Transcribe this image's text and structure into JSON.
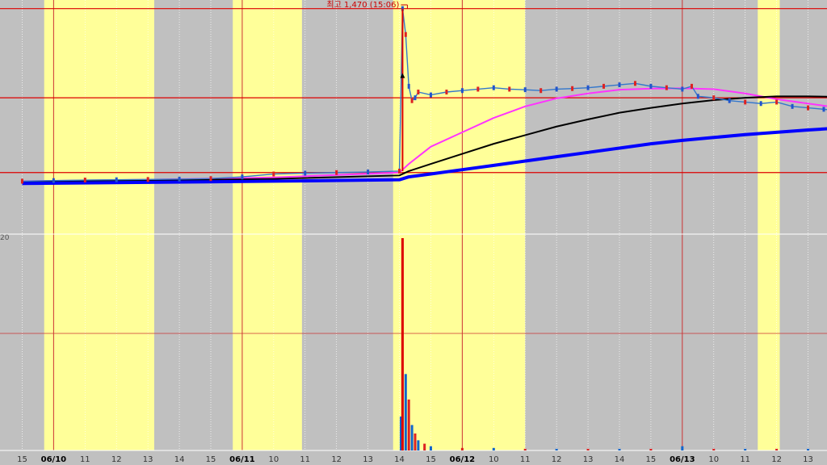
{
  "chart_data": {
    "type": "line",
    "title": "",
    "xlabel": "",
    "ylabel": "",
    "ylim": [
      700,
      1500
    ],
    "grid": true,
    "legend": "none",
    "time_ticks": [
      "15",
      "06/10",
      "11",
      "12",
      "13",
      "14",
      "15",
      "06/11",
      "10",
      "11",
      "12",
      "13",
      "14",
      "15",
      "06/12",
      "10",
      "11",
      "12",
      "13",
      "14",
      "15",
      "06/13",
      "10",
      "11",
      "12",
      "13"
    ],
    "date_ticks": [
      "06/10",
      "06/11",
      "06/12",
      "06/13"
    ],
    "y_axis_label": "20",
    "annotation": {
      "text": "최고 1,470 (15:06)",
      "x": 12.1,
      "y": 1470
    },
    "horizontal_lines": [
      1470,
      1160,
      900
    ],
    "highlight_bands": [
      [
        1.2,
        4.7
      ],
      [
        7.2,
        9.4
      ],
      [
        12.3,
        16.5
      ],
      [
        23.9,
        24.6
      ]
    ],
    "price_series": {
      "name": "",
      "x": [
        0,
        1,
        2,
        3,
        4,
        5,
        6,
        7,
        8,
        9,
        10,
        11,
        12,
        12.1,
        12.2,
        12.3,
        12.4,
        12.5,
        12.6,
        13,
        13.5,
        14,
        14.5,
        15,
        15.5,
        16,
        16.5,
        17,
        17.5,
        18,
        18.5,
        19,
        19.5,
        20,
        20.5,
        21,
        21.3,
        21.5,
        22,
        22.5,
        23,
        23.5,
        24,
        24.5,
        25,
        25.5,
        26,
        26.5,
        27
      ],
      "y": [
        870,
        872,
        874,
        875,
        876,
        877,
        879,
        885,
        895,
        898,
        900,
        902,
        905,
        1470,
        1380,
        1200,
        1150,
        1160,
        1180,
        1170,
        1180,
        1185,
        1190,
        1195,
        1190,
        1188,
        1185,
        1190,
        1192,
        1195,
        1200,
        1205,
        1210,
        1200,
        1195,
        1190,
        1200,
        1165,
        1160,
        1150,
        1145,
        1140,
        1145,
        1130,
        1125,
        1120,
        1115,
        1110,
        1108
      ]
    },
    "ma_series": [
      {
        "name": "",
        "color": "#ff33ff",
        "x": [
          0,
          4,
          8,
          12,
          12.3,
          13,
          14,
          15,
          16,
          17,
          18,
          19,
          20,
          21,
          22,
          23,
          24,
          25,
          26,
          27
        ],
        "y": [
          870,
          875,
          883,
          900,
          930,
          990,
          1040,
          1090,
          1130,
          1158,
          1175,
          1188,
          1192,
          1193,
          1190,
          1175,
          1155,
          1140,
          1125,
          1110
        ]
      },
      {
        "name": "",
        "color": "#000000",
        "x": [
          0,
          4,
          8,
          12,
          12.3,
          13,
          14,
          15,
          16,
          17,
          18,
          19,
          20,
          21,
          22,
          23,
          24,
          25,
          26,
          27
        ],
        "y": [
          868,
          872,
          878,
          890,
          905,
          930,
          965,
          1000,
          1030,
          1060,
          1085,
          1108,
          1125,
          1140,
          1152,
          1160,
          1165,
          1165,
          1163,
          1160
        ]
      },
      {
        "name": "",
        "color": "#0000ff",
        "x": [
          0,
          4,
          8,
          12,
          12.3,
          13,
          14,
          15,
          16,
          17,
          18,
          19,
          20,
          21,
          22,
          23,
          24,
          25,
          26,
          27
        ],
        "y": [
          862,
          866,
          870,
          875,
          885,
          895,
          910,
          925,
          940,
          955,
          970,
          985,
          1000,
          1012,
          1022,
          1032,
          1040,
          1048,
          1055,
          1062
        ]
      }
    ],
    "volume": {
      "name": "",
      "x": [
        12.05,
        12.1,
        12.2,
        12.3,
        12.4,
        12.5,
        12.6,
        12.8,
        13,
        14,
        15,
        16,
        17,
        18,
        19,
        20,
        21,
        22,
        23,
        24,
        25,
        26
      ],
      "values": [
        40,
        250,
        90,
        60,
        30,
        20,
        12,
        8,
        5,
        3,
        3,
        2,
        2,
        2,
        2,
        2,
        5,
        2,
        2,
        2,
        2,
        2
      ]
    }
  }
}
